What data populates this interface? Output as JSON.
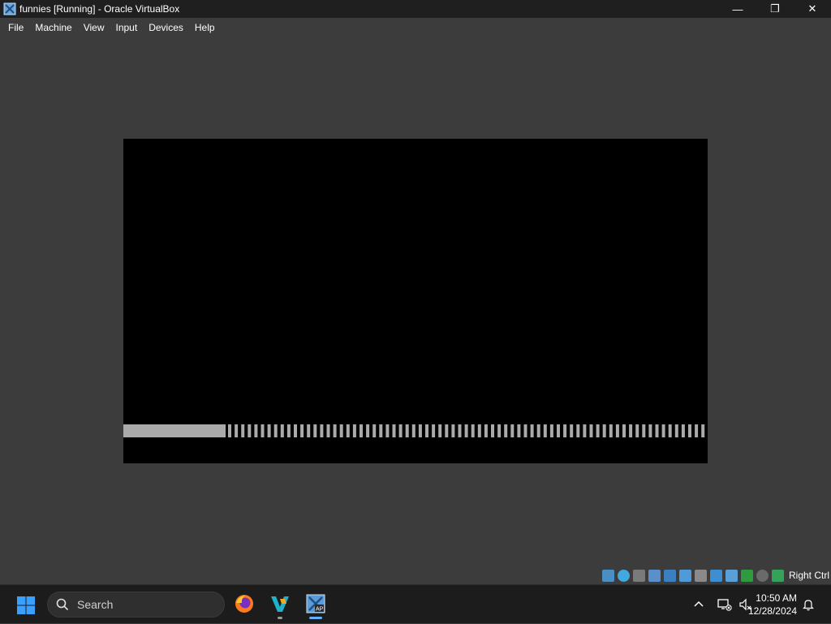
{
  "window": {
    "title": "funnies [Running] - Oracle VirtualBox",
    "controls": {
      "minimize": "—",
      "maximize": "❐",
      "close": "✕"
    }
  },
  "menu": [
    "File",
    "Machine",
    "View",
    "Input",
    "Devices",
    "Help"
  ],
  "vm": {
    "progress_fraction": 0.175
  },
  "statusbar": {
    "host_key": "Right Ctrl",
    "icons": [
      "hard-disk-icon",
      "optical-drive-icon",
      "floppy-icon",
      "audio-icon",
      "network-icon",
      "usb-icon",
      "shared-folders-icon",
      "display-icon",
      "video-capture-icon",
      "recording-icon",
      "cpu-icon",
      "mouse-integration-icon",
      "host-key-icon"
    ]
  },
  "taskbar": {
    "search_label": "Search",
    "apps": [
      "firefox-icon",
      "visual-studio-icon",
      "virtualbox-icon"
    ]
  },
  "clock": {
    "time": "10:50 AM",
    "date": "12/28/2024"
  },
  "colors": {
    "titlebar": "#1f1f1f",
    "window_bg": "#3c3c3c",
    "taskbar": "#1c1c1c",
    "progress": "#aaaaaa",
    "accent": "#0078d4"
  }
}
